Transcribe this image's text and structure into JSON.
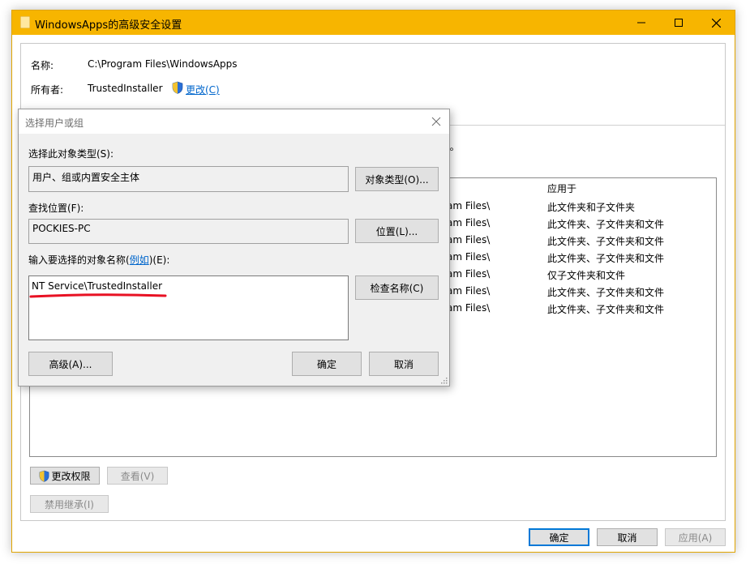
{
  "window": {
    "title": "WindowsApps的高级安全设置",
    "name_label": "名称:",
    "name_value": "C:\\Program Files\\WindowsApps",
    "owner_label": "所有者:",
    "owner_value": "TrustedInstaller",
    "change_link": "更改(C)",
    "hidden_text_fragment": ")。",
    "column_applies_to": "应用于",
    "rows": [
      {
        "path": "am Files\\",
        "applies": "此文件夹和子文件夹"
      },
      {
        "path": "am Files\\",
        "applies": "此文件夹、子文件夹和文件"
      },
      {
        "path": "am Files\\",
        "applies": "此文件夹、子文件夹和文件"
      },
      {
        "path": "am Files\\",
        "applies": "此文件夹、子文件夹和文件"
      },
      {
        "path": "am Files\\",
        "applies": "仅子文件夹和文件"
      },
      {
        "path": "am Files\\",
        "applies": "此文件夹、子文件夹和文件"
      },
      {
        "path": "am Files\\",
        "applies": "此文件夹、子文件夹和文件"
      }
    ],
    "btn_change_perm": "更改权限",
    "btn_view": "查看(V)",
    "btn_disable_inherit": "禁用继承(I)",
    "btn_ok": "确定",
    "btn_cancel": "取消",
    "btn_apply": "应用(A)"
  },
  "dialog": {
    "title": "选择用户或组",
    "object_type_label": "选择此对象类型(S):",
    "object_type_value": "用户、组或内置安全主体",
    "object_type_btn": "对象类型(O)...",
    "location_label": "查找位置(F):",
    "location_value": "POCKIES-PC",
    "location_btn": "位置(L)...",
    "enter_label_pre": "输入要选择的对象名称(",
    "enter_label_link": "例如",
    "enter_label_post": ")(E):",
    "entered_value": "NT Service\\TrustedInstaller",
    "check_names_btn": "检查名称(C)",
    "advanced_btn": "高级(A)...",
    "ok_btn": "确定",
    "cancel_btn": "取消"
  },
  "colors": {
    "titlebar": "#f7b500",
    "underline": "#e81123",
    "link": "#0066cc"
  }
}
